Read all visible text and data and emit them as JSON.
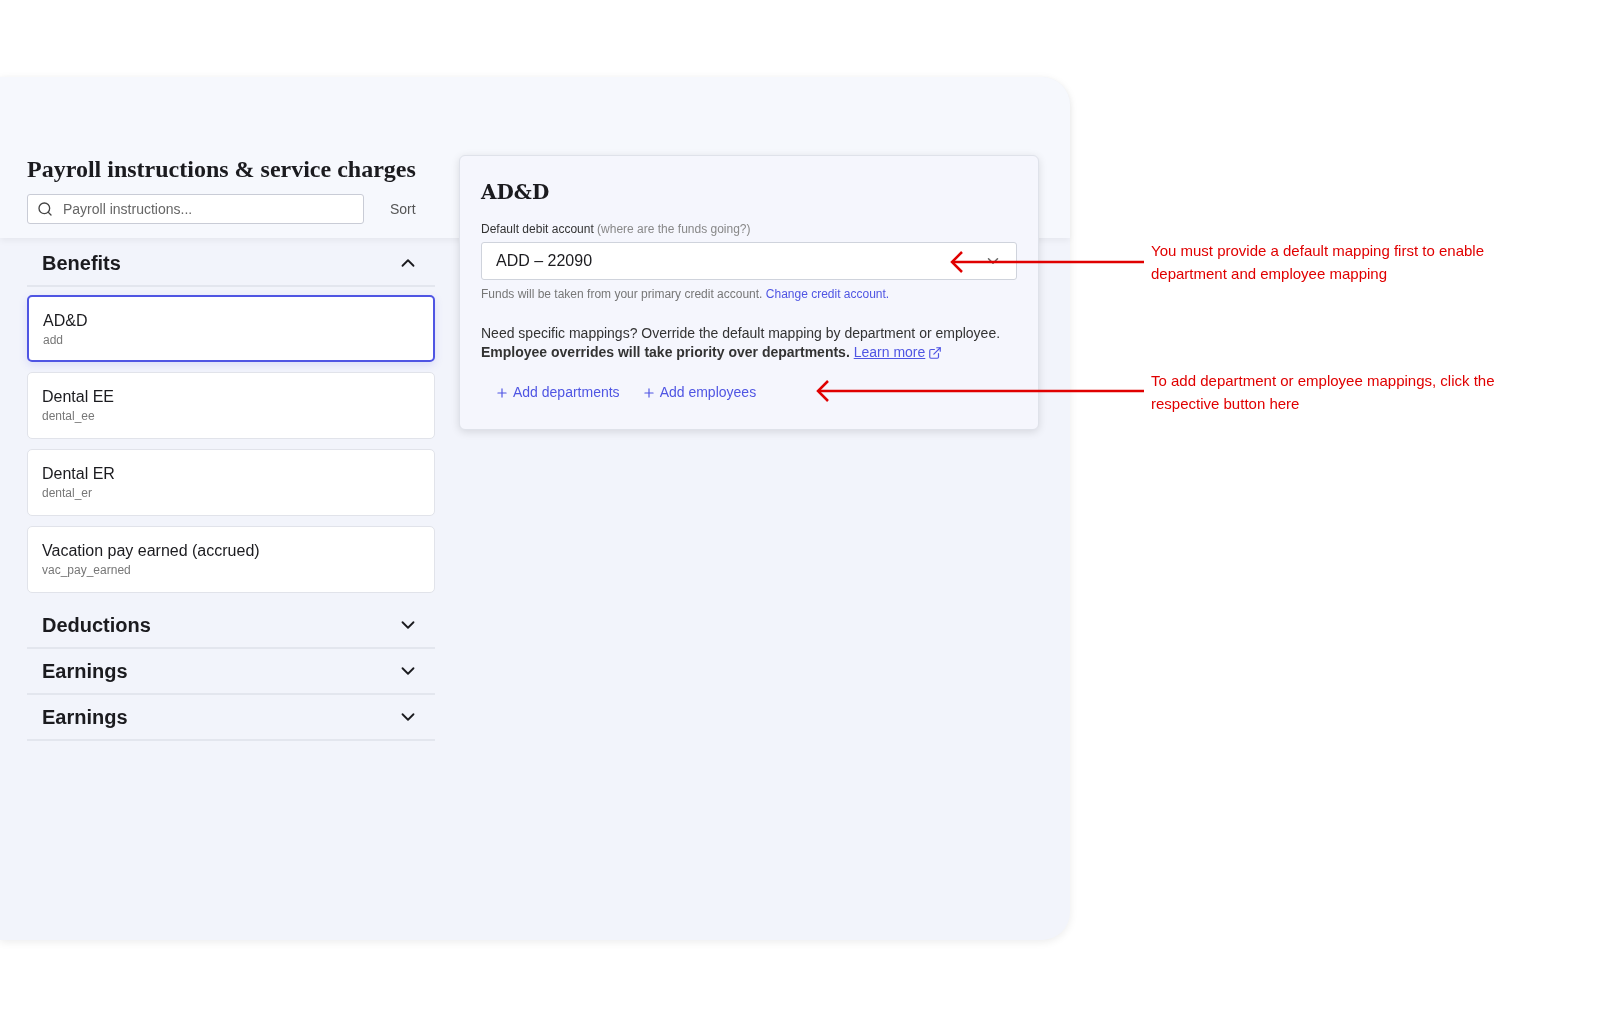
{
  "page_title": "Payroll instructions & service charges",
  "search": {
    "placeholder": "Payroll instructions..."
  },
  "sort_button": "Sort",
  "groups": [
    {
      "title": "Benefits",
      "expanded": true,
      "items": [
        {
          "name": "AD&D",
          "code": "add",
          "selected": true
        },
        {
          "name": "Dental EE",
          "code": "dental_ee",
          "selected": false
        },
        {
          "name": "Dental ER",
          "code": "dental_er",
          "selected": false
        },
        {
          "name": "Vacation pay earned (accrued)",
          "code": "vac_pay_earned",
          "selected": false
        }
      ]
    },
    {
      "title": "Deductions",
      "expanded": false
    },
    {
      "title": "Earnings",
      "expanded": false
    },
    {
      "title": "Earnings",
      "expanded": false
    }
  ],
  "detail": {
    "title": "AD&D",
    "field_label": "Default debit account",
    "field_hint": "(where are the funds going?)",
    "value": "ADD – 22090",
    "helper": "Funds will be taken from your primary credit account.",
    "helper_link": "Change credit account.",
    "note": "Need specific mappings? Override the default mapping by department or employee. **Employee overrides will take priority over departments.**",
    "note_link": "Learn more",
    "actions": [
      "Add departments",
      "Add employees"
    ]
  },
  "annotations": [
    {
      "text": "You must provide a default mapping first to enable department and employee mapping"
    },
    {
      "text": "To add department or employee mappings, click the respective button here"
    }
  ]
}
